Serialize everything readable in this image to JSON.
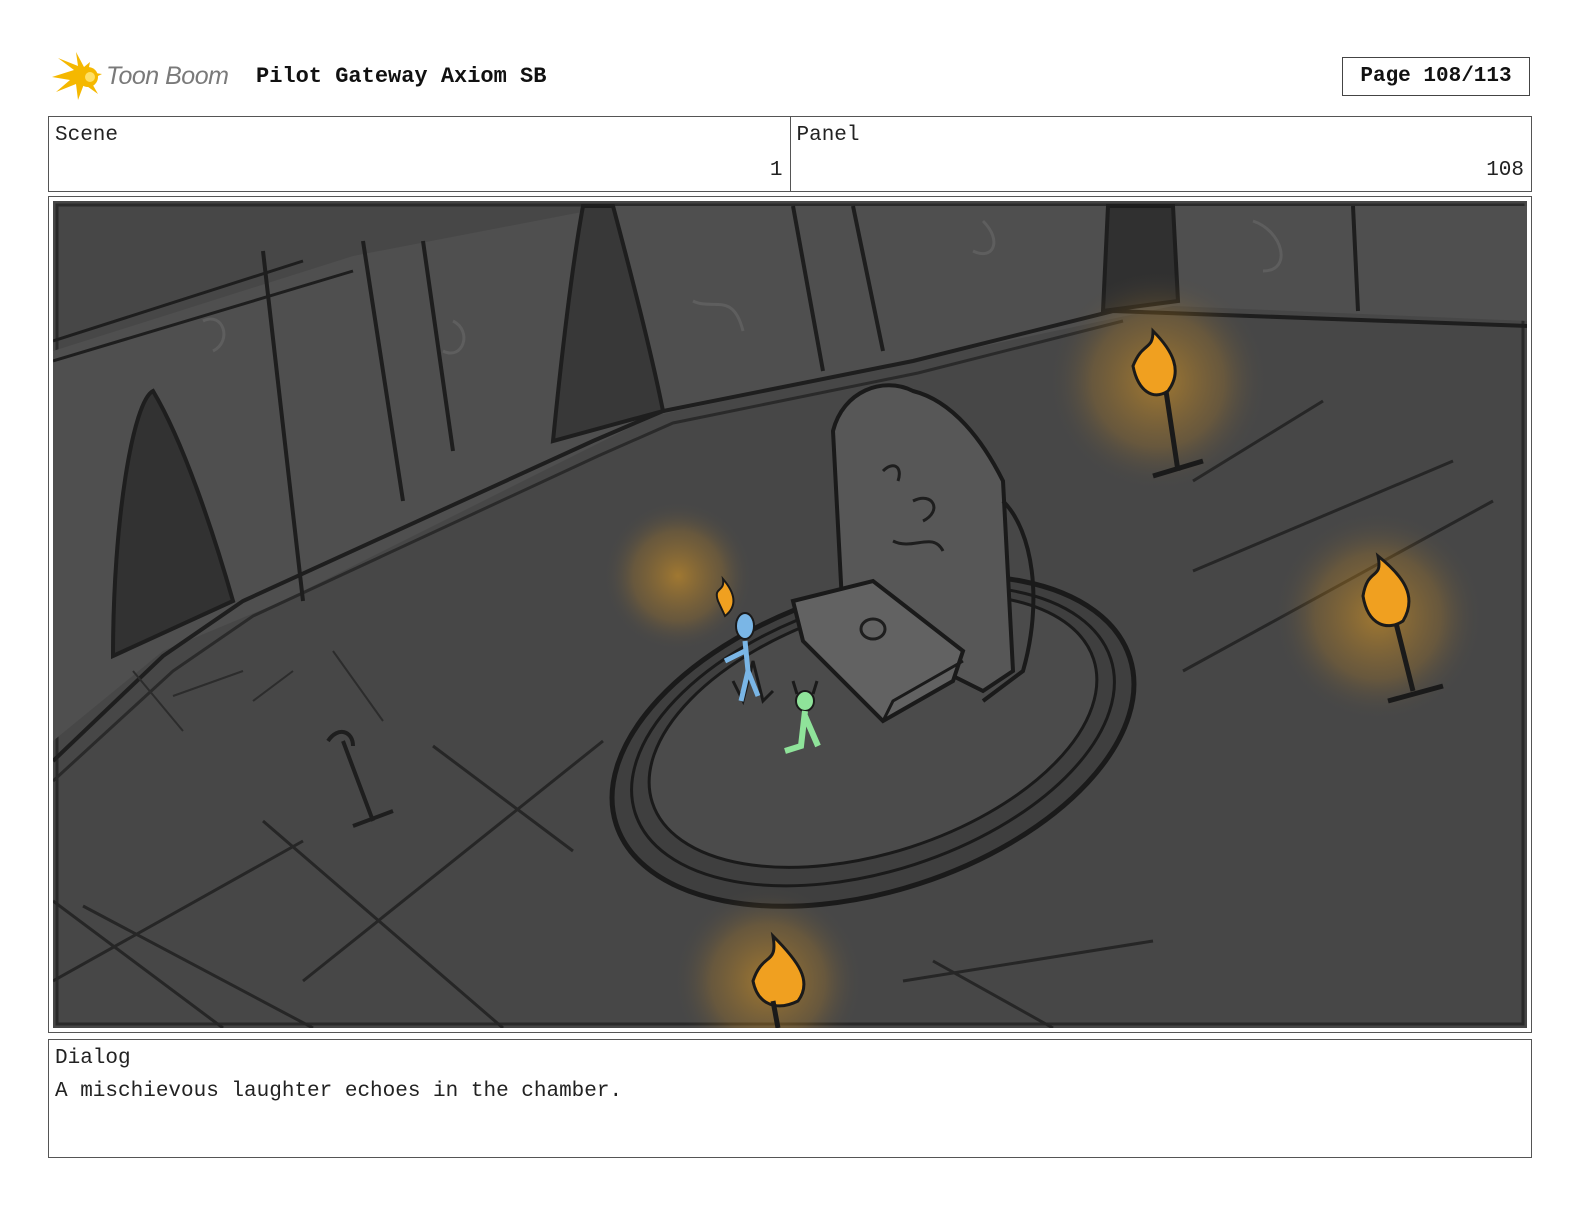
{
  "header": {
    "brand": "Toon Boom",
    "project_title": "Pilot Gateway Axiom SB",
    "page_label": "Page 108/113"
  },
  "scene": {
    "label": "Scene",
    "value": "1"
  },
  "panel": {
    "label": "Panel",
    "value": "108"
  },
  "dialog": {
    "label": "Dialog",
    "text": "A mischievous laughter echoes in the chamber."
  },
  "colors": {
    "panel_background": "#474747",
    "torch_glow": "#e9a020",
    "character_blue": "#7ab6e6",
    "character_green": "#8fe39a",
    "logo_accent": "#f5b800"
  }
}
